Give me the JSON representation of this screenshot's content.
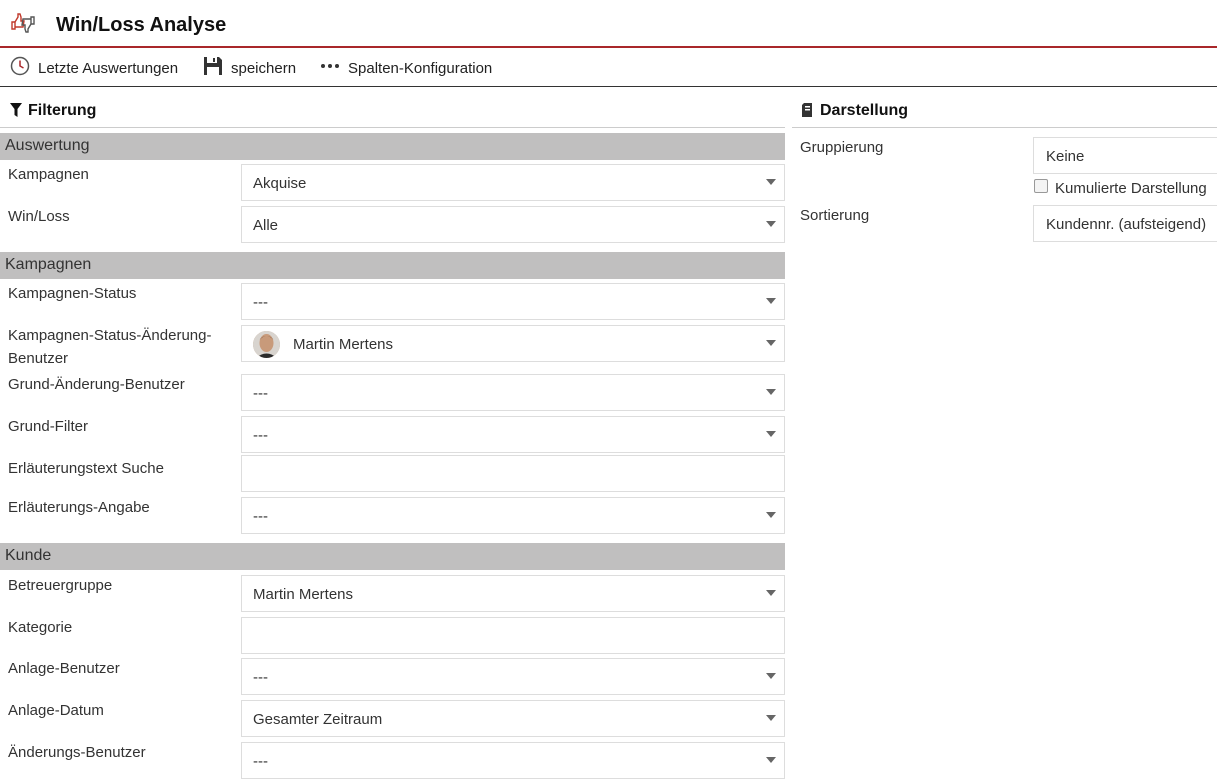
{
  "header": {
    "title": "Win/Loss Analyse",
    "logo_icon": "thumbs-up-down-icon",
    "accent_color": "#a9272a"
  },
  "toolbar": {
    "recent_label": "Letzte Auswertungen",
    "save_label": "speichern",
    "columns_label": "Spalten-Konfiguration"
  },
  "filter": {
    "title": "Filterung",
    "groups": {
      "auswertung": "Auswertung",
      "kampagnen": "Kampagnen",
      "kunde": "Kunde"
    },
    "fields": {
      "kampagnen": {
        "label": "Kampagnen",
        "value": "Akquise"
      },
      "winloss": {
        "label": "Win/Loss",
        "value": "Alle"
      },
      "kampagnen_status": {
        "label": "Kampagnen-Status",
        "value": "---"
      },
      "status_aenderung_benutzer": {
        "label": "Kampagnen-Status-Änderung-Benutzer",
        "value": "Martin Mertens"
      },
      "grund_aenderung_benutzer": {
        "label": "Grund-Änderung-Benutzer",
        "value": "---"
      },
      "grund_filter": {
        "label": "Grund-Filter",
        "value": "---"
      },
      "erlaeuterungstext_suche": {
        "label": "Erläuterungstext Suche",
        "value": ""
      },
      "erlaeuterungs_angabe": {
        "label": "Erläuterungs-Angabe",
        "value": "---"
      },
      "betreuergruppe": {
        "label": "Betreuergruppe",
        "value": "Martin Mertens"
      },
      "kategorie": {
        "label": "Kategorie",
        "value": ""
      },
      "anlage_benutzer": {
        "label": "Anlage-Benutzer",
        "value": "---"
      },
      "anlage_datum": {
        "label": "Anlage-Datum",
        "value": "Gesamter Zeitraum"
      },
      "aenderungs_benutzer": {
        "label": "Änderungs-Benutzer",
        "value": "---"
      }
    }
  },
  "darstellung": {
    "title": "Darstellung",
    "gruppierung": {
      "label": "Gruppierung",
      "value": "Keine"
    },
    "kumuliert": {
      "label": "Kumulierte Darstellung",
      "checked": false
    },
    "sortierung": {
      "label": "Sortierung",
      "value": "Kundennr. (aufsteigend)"
    }
  }
}
